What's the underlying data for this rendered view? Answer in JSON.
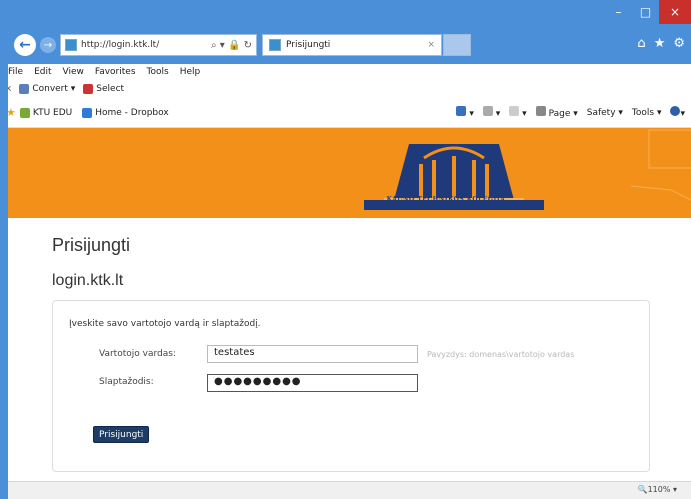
{
  "browser": {
    "address_url": "http://login.ktk.lt/",
    "address_controls": "⌕ ▾ 🔒 ↻",
    "tab_title": "Prisijungti",
    "tab_close": "×",
    "window_controls": [
      "–",
      "□",
      "×"
    ],
    "right_icons": [
      "⌂",
      "★",
      "⚙"
    ]
  },
  "menubar": [
    "File",
    "Edit",
    "View",
    "Favorites",
    "Tools",
    "Help"
  ],
  "cmdbar": {
    "close": "x",
    "convert": "Convert ▾",
    "select": "Select"
  },
  "favbar": {
    "items": [
      "KTU EDU",
      "Home - Dropbox"
    ],
    "tools": [
      "▾",
      "▾",
      "▾",
      "Page ▾",
      "Safety ▾",
      "Tools ▾",
      "▾"
    ]
  },
  "header": {
    "logo_text": "KAUNO TECHNIKOS KOLEGIJA"
  },
  "page": {
    "title": "Prisijungti",
    "subtitle": "login.ktk.lt",
    "intro": "Įveskite savo vartotojo vardą ir slaptažodį.",
    "username_label": "Vartotojo vardas:",
    "username_value": "testates",
    "username_hint": "Pavyzdys: domenas\\vartotojo vardas",
    "password_label": "Slaptažodis:",
    "password_value": "●●●●●●●●●",
    "submit_label": "Prisijungti"
  },
  "status": {
    "zoom": "🔍110%  ▾"
  },
  "colors": {
    "accent_orange": "#f39019",
    "title_blue": "#4a8fd8",
    "button_navy": "#1d3d66"
  }
}
